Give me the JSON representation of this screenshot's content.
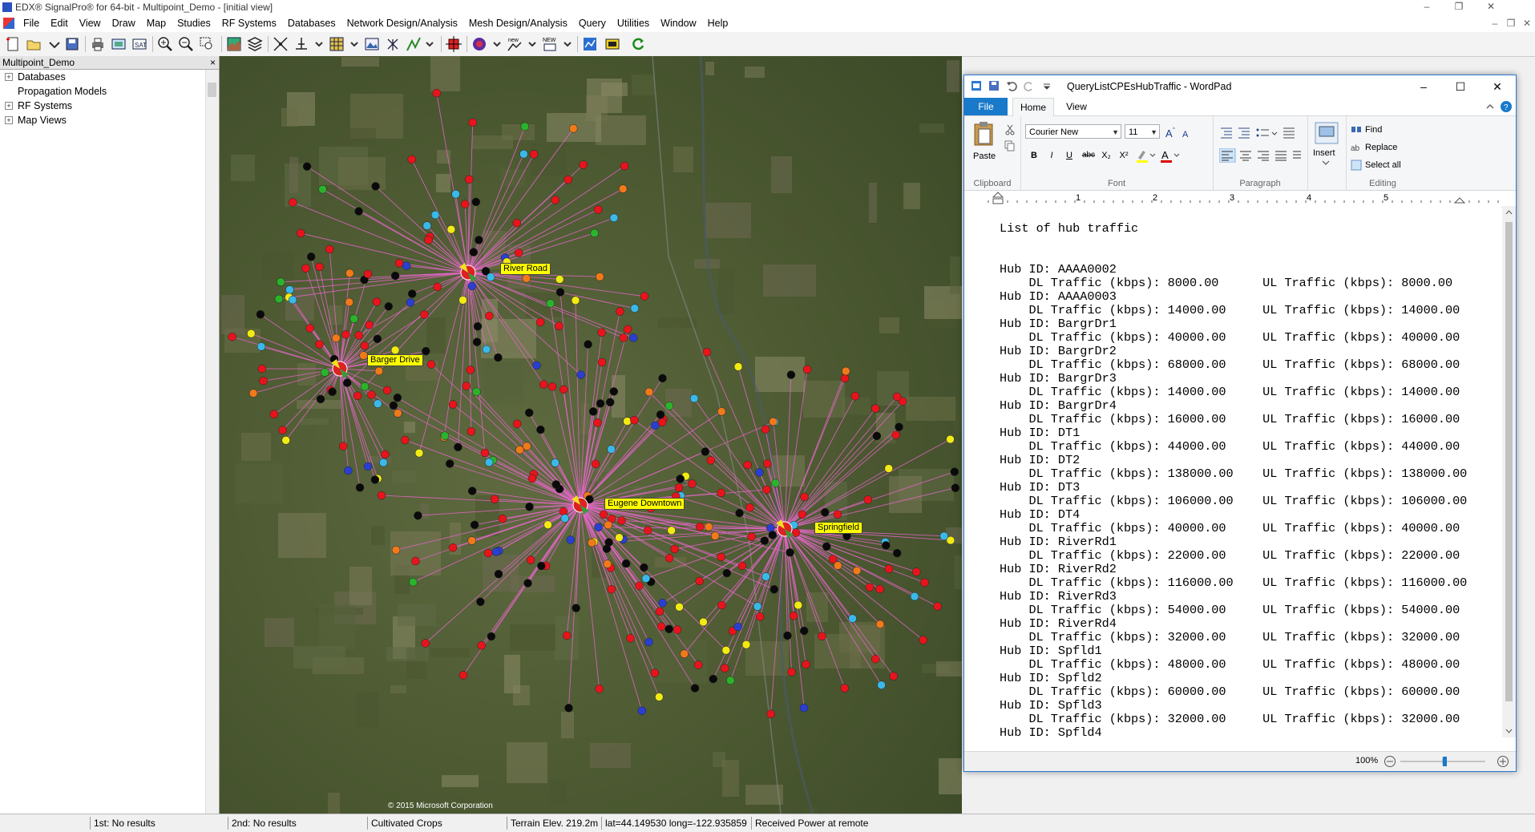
{
  "app": {
    "title": "EDX® SignalPro®  for 64-bit - Multipoint_Demo - [initial view]",
    "window_controls": [
      "–",
      "❐",
      "✕"
    ],
    "mdi_controls": [
      "–",
      "❐",
      "✕"
    ]
  },
  "menu": [
    "File",
    "Edit",
    "View",
    "Draw",
    "Map",
    "Studies",
    "RF Systems",
    "Databases",
    "Network Design/Analysis",
    "Mesh Design/Analysis",
    "Query",
    "Utilities",
    "Window",
    "Help"
  ],
  "toolbar_icons": [
    "new-icon",
    "open-icon",
    "save-icon",
    "print-icon",
    "map-view-icon",
    "fit-icon",
    "zoom-in-icon",
    "zoom-out-icon",
    "zoom-box-icon",
    "terrain-icon",
    "layers-icon",
    "measure-icon",
    "profile-icon",
    "grid-icon",
    "image-icon",
    "antenna-icon",
    "path-icon",
    "crosshair-icon",
    "globe-icon",
    "new-link-icon",
    "new-site-icon",
    "analysis-icon",
    "signal-icon",
    "refresh-icon"
  ],
  "project_tree": {
    "title": "Multipoint_Demo",
    "close": "×",
    "items": [
      {
        "label": "Databases",
        "expander": "+"
      },
      {
        "label": "Propagation Models",
        "expander": ""
      },
      {
        "label": "RF Systems",
        "expander": "+"
      },
      {
        "label": "Map Views",
        "expander": "+"
      }
    ]
  },
  "map": {
    "hubs": [
      {
        "label": "River Road"
      },
      {
        "label": "Barger Drive"
      },
      {
        "label": "Eugene Downtown"
      },
      {
        "label": "Springfield"
      }
    ],
    "link_color": "#e466c8",
    "cpe_colors": {
      "red": "#e8141c",
      "black": "#0a0a0a",
      "blue": "#2a3fd1",
      "yellow": "#f2ea14",
      "orange": "#f07a1a",
      "green": "#2bb32b",
      "cyan": "#3ab9e8"
    },
    "copyright": "© 2015 Microsoft Corporation"
  },
  "status": {
    "first": "1st:  No results",
    "second": "2nd:  No results",
    "landcover": "Cultivated Crops",
    "terrain": "Terrain Elev. 219.2m",
    "coords": "lat=44.149530  long=-122.935859",
    "received": "Received Power at remote"
  },
  "wordpad": {
    "title": "QueryListCPEsHubTraffic - WordPad",
    "controls": [
      "–",
      "☐",
      "✕"
    ],
    "tabs": {
      "file": "File",
      "home": "Home",
      "view": "View"
    },
    "ribbon": {
      "paste": "Paste",
      "clipboard": "Clipboard",
      "font_name": "Courier New",
      "font_size": "11",
      "font": "Font",
      "paragraph": "Paragraph",
      "insert": "Insert",
      "find": "Find",
      "replace": "Replace",
      "select_all": "Select all",
      "editing": "Editing",
      "bold": "B",
      "italic": "I",
      "underline": "U",
      "strike": "abc",
      "subscript": "X₂",
      "superscript": "X²"
    },
    "ruler": [
      "1",
      "2",
      "3",
      "4",
      "5"
    ],
    "zoom": "100%",
    "document": {
      "heading": "List of hub traffic",
      "hubs": [
        {
          "id": "AAAA0002",
          "dl": "8000.00",
          "ul": "8000.00"
        },
        {
          "id": "AAAA0003",
          "dl": "14000.00",
          "ul": "14000.00"
        },
        {
          "id": "BargrDr1",
          "dl": "40000.00",
          "ul": "40000.00"
        },
        {
          "id": "BargrDr2",
          "dl": "68000.00",
          "ul": "68000.00"
        },
        {
          "id": "BargrDr3",
          "dl": "14000.00",
          "ul": "14000.00"
        },
        {
          "id": "BargrDr4",
          "dl": "16000.00",
          "ul": "16000.00"
        },
        {
          "id": "DT1",
          "dl": "44000.00",
          "ul": "44000.00"
        },
        {
          "id": "DT2",
          "dl": "138000.00",
          "ul": "138000.00"
        },
        {
          "id": "DT3",
          "dl": "106000.00",
          "ul": "106000.00"
        },
        {
          "id": "DT4",
          "dl": "40000.00",
          "ul": "40000.00"
        },
        {
          "id": "RiverRd1",
          "dl": "22000.00",
          "ul": "22000.00"
        },
        {
          "id": "RiverRd2",
          "dl": "116000.00",
          "ul": "116000.00"
        },
        {
          "id": "RiverRd3",
          "dl": "54000.00",
          "ul": "54000.00"
        },
        {
          "id": "RiverRd4",
          "dl": "32000.00",
          "ul": "32000.00"
        },
        {
          "id": "Spfld1",
          "dl": "48000.00",
          "ul": "48000.00"
        },
        {
          "id": "Spfld2",
          "dl": "60000.00",
          "ul": "60000.00"
        },
        {
          "id": "Spfld3",
          "dl": "32000.00",
          "ul": "32000.00"
        },
        {
          "id": "Spfld4",
          "dl": "",
          "ul": ""
        }
      ],
      "hub_prefix": "Hub ID: ",
      "dl_prefix": "DL Traffic (kbps): ",
      "ul_prefix": "UL Traffic (kbps): "
    }
  }
}
